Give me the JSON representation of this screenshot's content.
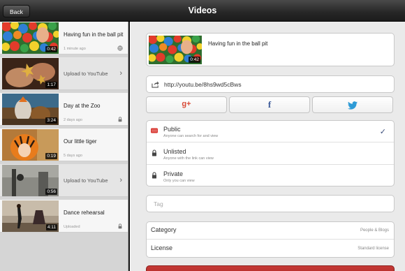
{
  "nav": {
    "title": "Videos",
    "back_label": "Back"
  },
  "list": [
    {
      "title": "Having fun in the ball pit",
      "subtitle": "1 minute ago",
      "duration": "0:42",
      "status_icon": "globe-icon"
    },
    {
      "title": "Upload to YouTube",
      "duration": "1:17",
      "action": "chevron-right-icon"
    },
    {
      "title": "Day at the Zoo",
      "subtitle": "2 days ago",
      "duration": "3:24",
      "status_icon": "lock-icon"
    },
    {
      "title": "Our little tiger",
      "subtitle": "5 days ago",
      "duration": "0:19"
    },
    {
      "title": "Upload to YouTube",
      "duration": "0:56",
      "action": "chevron-right-icon"
    },
    {
      "title": "Dance rehearsal",
      "subtitle": "Uploaded",
      "duration": "4:11",
      "status_icon": "lock-icon"
    }
  ],
  "detail": {
    "video": {
      "title": "Having fun in the ball pit",
      "duration": "0:42"
    },
    "link": {
      "url": "http://youtu.be/8hs9wd5cBws",
      "icon": "share-icon"
    },
    "share": [
      {
        "label": "g+",
        "icon": "google-plus-icon",
        "color": "#d84a36"
      },
      {
        "label": "f",
        "icon": "facebook-icon",
        "color": "#3b5998"
      },
      {
        "label": "",
        "icon": "twitter-icon",
        "color": "#2e9bd6"
      }
    ],
    "privacy": [
      {
        "label": "Public",
        "desc": "Anyone can search for and view",
        "icon": "youtube-icon",
        "selected": true
      },
      {
        "label": "Unlisted",
        "desc": "Anyone with the link can view",
        "icon": "lock-icon",
        "selected": false
      },
      {
        "label": "Private",
        "desc": "Only you can view",
        "icon": "lock-icon",
        "selected": false
      }
    ],
    "check_glyph": "✓",
    "tag": {
      "placeholder": "Tag",
      "value": ""
    },
    "category": {
      "label": "Category",
      "value": "People & Blogs"
    },
    "license": {
      "label": "License",
      "value": "Standard license"
    }
  },
  "colors": {
    "accent": "#3a4d7a",
    "upload_button": "#b8302d",
    "navbar": "#262626"
  }
}
